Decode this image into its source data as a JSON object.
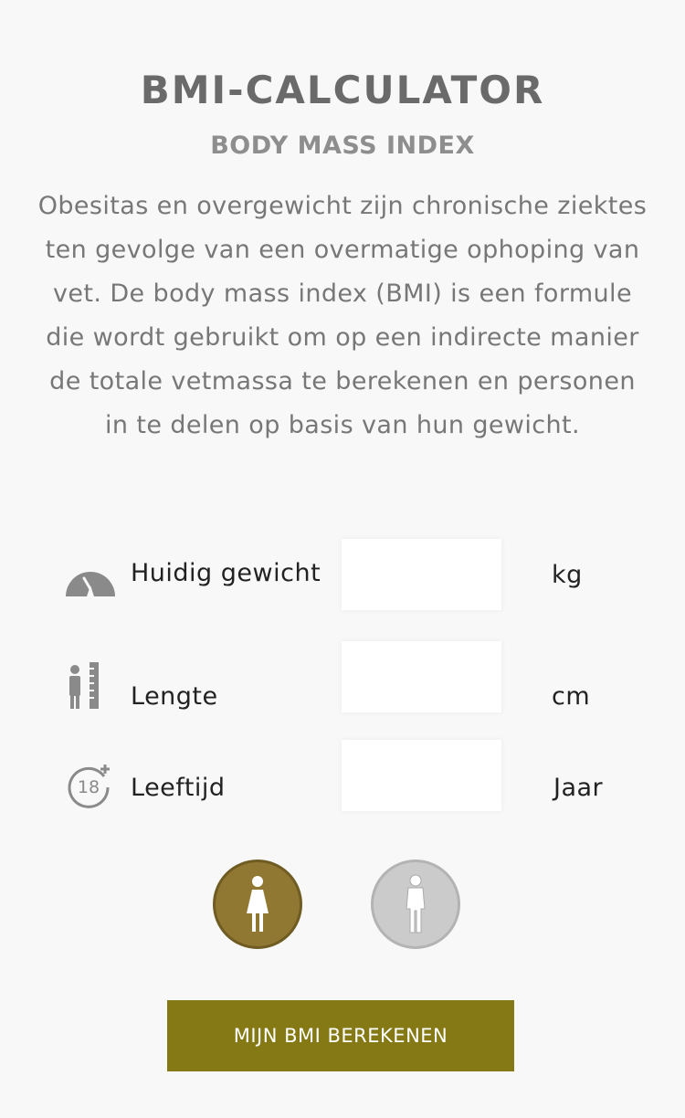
{
  "header": {
    "title": "BMI-CALCULATOR",
    "subtitle": "BODY MASS INDEX",
    "description": "Obesitas en overgewicht zijn chronische ziektes ten gevolge van een overmatige ophoping van vet. De body mass index (BMI) is een formule die wordt gebruikt om op een indirecte manier de totale vetmassa te berekenen en personen in te delen op basis van hun gewicht."
  },
  "form": {
    "weight": {
      "label": "Huidig gewicht",
      "value": "",
      "placeholder": "",
      "unit": "kg",
      "icon": "speedometer-icon"
    },
    "height": {
      "label": "Lengte",
      "value": "",
      "placeholder": "",
      "unit": "cm",
      "icon": "height-ruler-icon"
    },
    "age": {
      "label": "Leeftijd",
      "value": "",
      "placeholder": "",
      "unit": "Jaar",
      "icon": "age-18-plus-icon"
    }
  },
  "gender": {
    "selected": "female",
    "options": [
      {
        "id": "female",
        "icon": "female-icon"
      },
      {
        "id": "male",
        "icon": "male-icon"
      }
    ]
  },
  "actions": {
    "calculate_label": "MIJN BMI BEREKENEN"
  },
  "colors": {
    "background": "#f8f8f8",
    "accent": "#857916",
    "female_selected": "#917832",
    "male_unselected": "#cbcbcb",
    "icon_gray": "#8a8a8a"
  }
}
